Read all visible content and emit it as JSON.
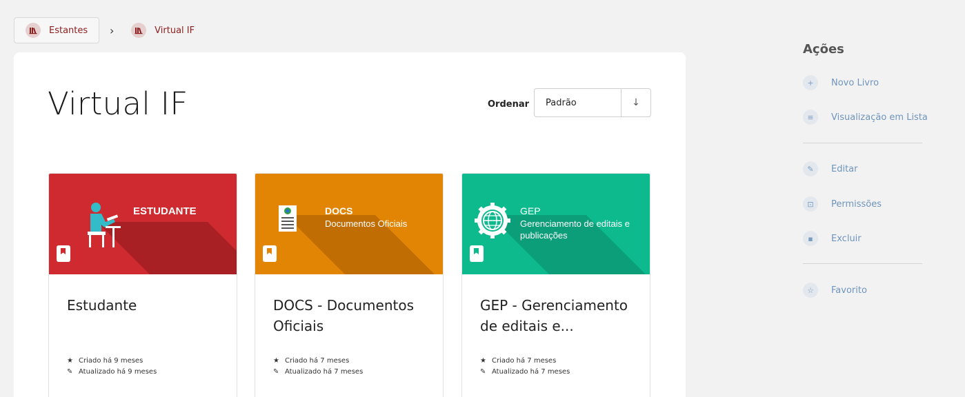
{
  "breadcrumb": {
    "items": [
      {
        "label": "Estantes"
      },
      {
        "label": "Virtual IF"
      }
    ]
  },
  "page": {
    "title": "Virtual IF",
    "sort_label": "Ordenar",
    "sort_value": "Padrão",
    "sort_direction": "↓"
  },
  "books": [
    {
      "cover_title": "ESTUDANTE",
      "cover_subtitle": "",
      "cover_color": "#cf2a2f",
      "name": "Estudante",
      "created": "Criado há 9 meses",
      "updated": "Atualizado há 9 meses"
    },
    {
      "cover_title": "DOCS",
      "cover_subtitle": "Documentos Oficiais",
      "cover_color": "#e28505",
      "name": "DOCS - Documentos Oficiais",
      "created": "Criado há 7 meses",
      "updated": "Atualizado há 7 meses"
    },
    {
      "cover_title": "GEP",
      "cover_subtitle": "Gerenciamento de editais e publicações",
      "cover_color": "#0dba8e",
      "name": "GEP - Gerenciamento de editais e...",
      "created": "Criado há 7 meses",
      "updated": "Atualizado há 7 meses"
    }
  ],
  "sidebar": {
    "title": "Ações",
    "items": [
      {
        "label": "Novo Livro",
        "icon": "plus-icon"
      },
      {
        "label": "Visualização em Lista",
        "icon": "list-icon"
      },
      {
        "label": "Editar",
        "icon": "pencil-icon"
      },
      {
        "label": "Permissões",
        "icon": "lock-icon"
      },
      {
        "label": "Excluir",
        "icon": "trash-icon"
      },
      {
        "label": "Favorito",
        "icon": "star-icon"
      }
    ]
  }
}
